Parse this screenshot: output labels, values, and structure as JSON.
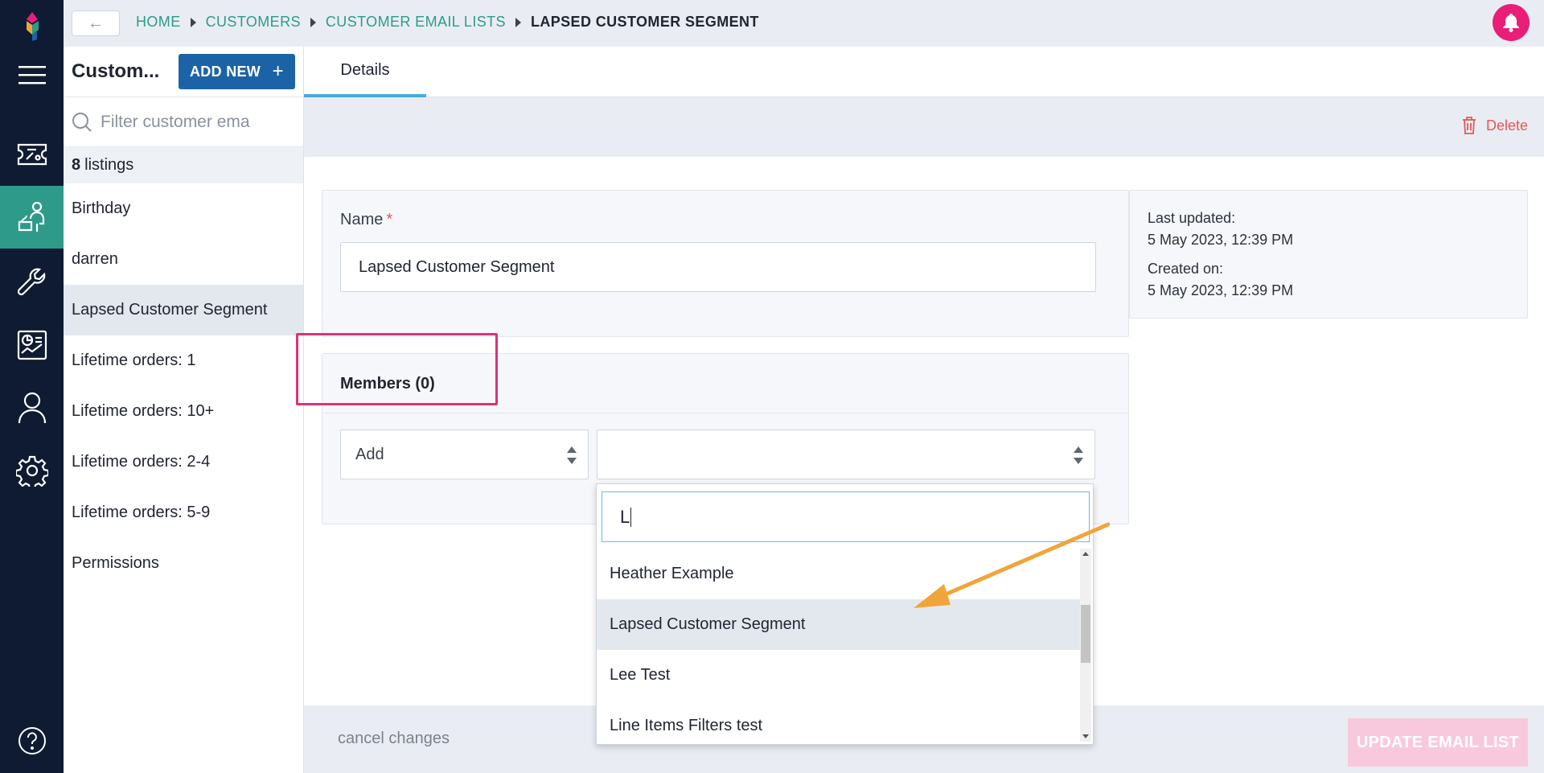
{
  "rail": {
    "items": [
      {
        "name": "logo-icon"
      },
      {
        "name": "menu-icon"
      },
      {
        "name": "ticket-icon"
      },
      {
        "name": "customers-icon",
        "active": true
      },
      {
        "name": "wrench-icon"
      },
      {
        "name": "reports-icon"
      },
      {
        "name": "user-icon"
      },
      {
        "name": "settings-icon"
      },
      {
        "name": "help-icon"
      }
    ],
    "accent": "#2e9a8a"
  },
  "topbar": {
    "back_label": "←",
    "breadcrumb": [
      "HOME",
      "CUSTOMERS",
      "CUSTOMER EMAIL LISTS",
      "LAPSED CUSTOMER SEGMENT"
    ]
  },
  "listpane": {
    "title": "Custom...",
    "add_new_label": "ADD NEW",
    "add_new_icon": "+",
    "search_placeholder": "Filter customer ema",
    "count": "8",
    "count_label": "listings",
    "items": [
      "Birthday",
      "darren",
      "Lapsed Customer Segment",
      "Lifetime orders: 1",
      "Lifetime orders: 10+",
      "Lifetime orders: 2-4",
      "Lifetime orders: 5-9",
      "Permissions"
    ],
    "selected_index": 2
  },
  "main": {
    "tab_label": "Details",
    "delete_label": "Delete",
    "name_label": "Name",
    "required_mark": "*",
    "name_value": "Lapsed Customer Segment",
    "meta": {
      "last_updated_label": "Last updated:",
      "last_updated_value": "5 May 2023, 12:39 PM",
      "created_label": "Created on:",
      "created_value": "5 May 2023, 12:39 PM"
    },
    "members_title": "Members (0)",
    "action_select_value": "Add",
    "target_select_value": "",
    "cancel_label": "cancel changes",
    "update_label": "UPDATE EMAIL LIST"
  },
  "dropdown": {
    "search_value": "L",
    "options": [
      "Heather Example",
      "Lapsed Customer Segment",
      "Lee Test",
      "Line Items Filters test"
    ],
    "hover_index": 1
  },
  "colors": {
    "rail_bg": "#0e1b33",
    "primary_button": "#1c63a6",
    "danger": "#e85656",
    "bell": "#e91e78",
    "annotation_box": "#d9337b",
    "annotation_arrow": "#f0a53a"
  }
}
